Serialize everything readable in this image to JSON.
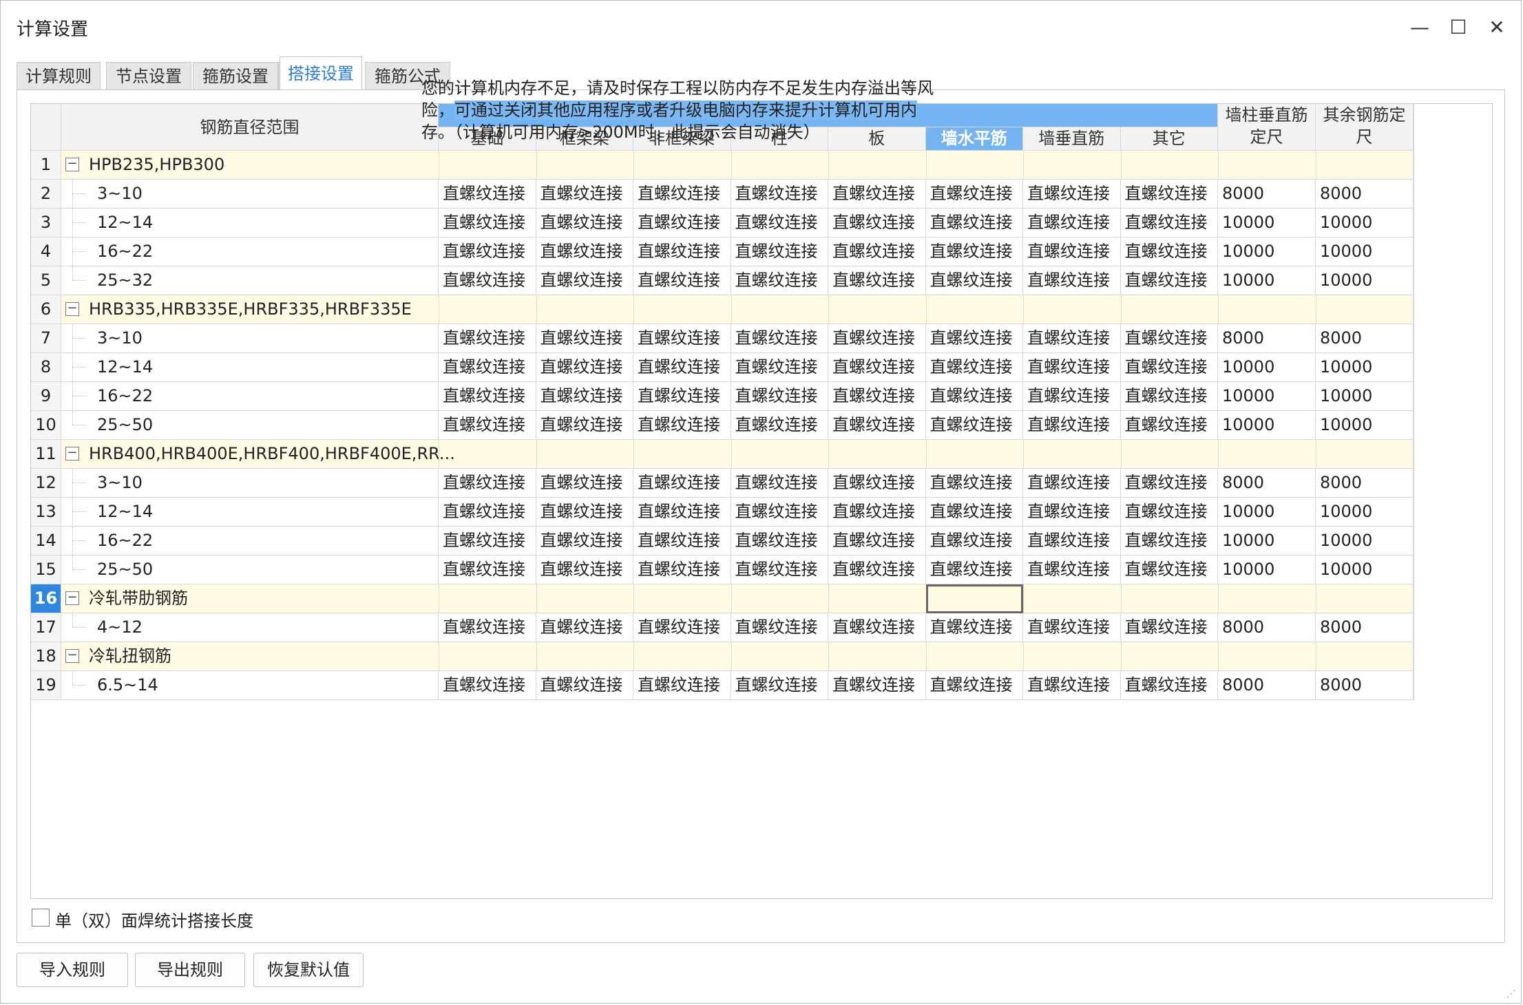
{
  "window": {
    "title": "计算设置"
  },
  "tabs": [
    {
      "label": "计算规则",
      "active": false
    },
    {
      "label": "节点设置",
      "active": false
    },
    {
      "label": "箍筋设置",
      "active": false
    },
    {
      "label": "搭接设置",
      "active": true
    },
    {
      "label": "箍筋公式",
      "active": false
    }
  ],
  "tooltip": {
    "line1": "您的计算机内存不足，请及时保存工程以防内存不足发生内存溢出等风",
    "line2a": "险，",
    "line2b": "可通过关闭其他应用程序或者升级电脑内存来提升计算机可用内",
    "line3": "存。（计算机可用内存>200M时，此提示会自动消失）"
  },
  "table": {
    "headers": {
      "range": "钢筋直径范围",
      "cols": [
        "基础",
        "框架梁",
        "非框架梁",
        "柱",
        "板",
        "墙水平筋",
        "墙垂直筋",
        "其它"
      ],
      "colA": "墙柱垂直筋定尺",
      "colB": "其余钢筋定尺"
    },
    "groups": [
      {
        "row": 1,
        "name": "HPB235,HPB300",
        "items": [
          {
            "row": 2,
            "range": "3~10",
            "a": "8000",
            "b": "8000"
          },
          {
            "row": 3,
            "range": "12~14",
            "a": "10000",
            "b": "10000"
          },
          {
            "row": 4,
            "range": "16~22",
            "a": "10000",
            "b": "10000"
          },
          {
            "row": 5,
            "range": "25~32",
            "a": "10000",
            "b": "10000"
          }
        ]
      },
      {
        "row": 6,
        "name": "HRB335,HRB335E,HRBF335,HRBF335E",
        "items": [
          {
            "row": 7,
            "range": "3~10",
            "a": "8000",
            "b": "8000"
          },
          {
            "row": 8,
            "range": "12~14",
            "a": "10000",
            "b": "10000"
          },
          {
            "row": 9,
            "range": "16~22",
            "a": "10000",
            "b": "10000"
          },
          {
            "row": 10,
            "range": "25~50",
            "a": "10000",
            "b": "10000"
          }
        ]
      },
      {
        "row": 11,
        "name": "HRB400,HRB400E,HRBF400,HRBF400E,RR...",
        "items": [
          {
            "row": 12,
            "range": "3~10",
            "a": "8000",
            "b": "8000"
          },
          {
            "row": 13,
            "range": "12~14",
            "a": "10000",
            "b": "10000"
          },
          {
            "row": 14,
            "range": "16~22",
            "a": "10000",
            "b": "10000"
          },
          {
            "row": 15,
            "range": "25~50",
            "a": "10000",
            "b": "10000"
          }
        ]
      },
      {
        "row": 16,
        "name": "冷轧带肋钢筋",
        "selected": true,
        "items": [
          {
            "row": 17,
            "range": "4~12",
            "a": "8000",
            "b": "8000"
          }
        ]
      },
      {
        "row": 18,
        "name": "冷轧扭钢筋",
        "items": [
          {
            "row": 19,
            "range": "6.5~14",
            "a": "8000",
            "b": "8000"
          }
        ]
      }
    ],
    "connection_value": "直螺纹连接"
  },
  "options": {
    "weld_checkbox_label": "单（双）面焊统计搭接长度",
    "weld_checked": false
  },
  "buttons": {
    "import": "导入规则",
    "export": "导出规则",
    "restore": "恢复默认值"
  },
  "colors": {
    "accent": "#2b7cd3",
    "group_bg": "#fffbe5",
    "header_highlight": "#75b4f2",
    "selected_row": "#2e86de"
  }
}
